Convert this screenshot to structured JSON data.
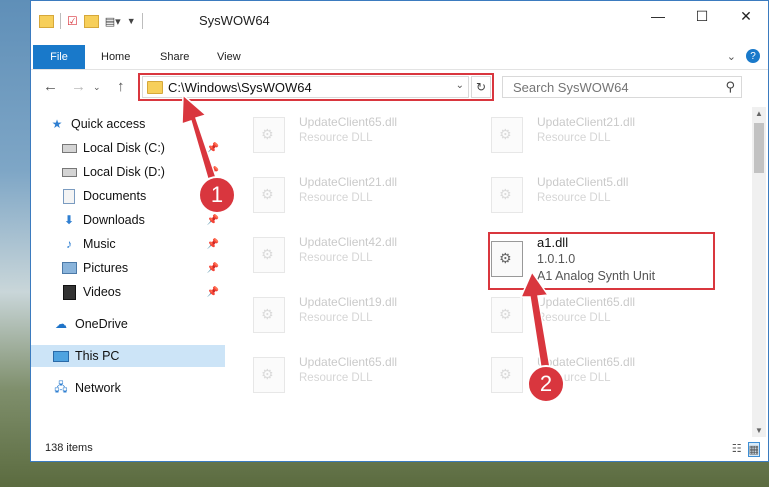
{
  "window": {
    "title": "SysWOW64"
  },
  "window_controls": {
    "minimize": "—",
    "maximize": "☐",
    "close": "✕"
  },
  "ribbon": {
    "file": "File",
    "tabs": [
      "Home",
      "Share",
      "View"
    ]
  },
  "address": {
    "path": "C:\\Windows\\SysWOW64"
  },
  "search": {
    "placeholder": "Search SysWOW64"
  },
  "sidebar": {
    "items": [
      {
        "label": "Quick access",
        "icon": "star-icon",
        "pinned": false
      },
      {
        "label": "Local Disk (C:)",
        "icon": "drive-icon",
        "pinned": true
      },
      {
        "label": "Local Disk (D:)",
        "icon": "drive-icon",
        "pinned": true
      },
      {
        "label": "Documents",
        "icon": "documents-icon",
        "pinned": true
      },
      {
        "label": "Downloads",
        "icon": "download-icon",
        "pinned": true
      },
      {
        "label": "Music",
        "icon": "music-icon",
        "pinned": true
      },
      {
        "label": "Pictures",
        "icon": "pictures-icon",
        "pinned": true
      },
      {
        "label": "Videos",
        "icon": "videos-icon",
        "pinned": true
      },
      {
        "label": "OneDrive",
        "icon": "cloud-icon",
        "pinned": false
      },
      {
        "label": "This PC",
        "icon": "computer-icon",
        "pinned": false,
        "selected": true
      },
      {
        "label": "Network",
        "icon": "network-icon",
        "pinned": false
      }
    ]
  },
  "files": [
    {
      "name": "UpdateClient65.dll",
      "desc": "Resource DLL"
    },
    {
      "name": "UpdateClient21.dll",
      "desc": "Resource DLL"
    },
    {
      "name": "UpdateClient21.dll",
      "desc": "Resource DLL"
    },
    {
      "name": "UpdateClient5.dll",
      "desc": "Resource DLL"
    },
    {
      "name": "UpdateClient42.dll",
      "desc": "Resource DLL"
    },
    {
      "name": "a1.dll",
      "version": "1.0.1.0",
      "desc": "A1 Analog Synth Unit"
    },
    {
      "name": "UpdateClient19.dll",
      "desc": "Resource DLL"
    },
    {
      "name": "UpdateClient65.dll",
      "desc": "Resource DLL"
    },
    {
      "name": "UpdateClient65.dll",
      "desc": "Resource DLL"
    },
    {
      "name": "UpdateClient65.dll",
      "desc": "Resource DLL"
    }
  ],
  "status": {
    "items": "138 items"
  },
  "markers": {
    "one": "1",
    "two": "2"
  },
  "colors": {
    "accent": "#1979ca",
    "highlight": "#d9363e",
    "selected": "#cce4f7"
  }
}
